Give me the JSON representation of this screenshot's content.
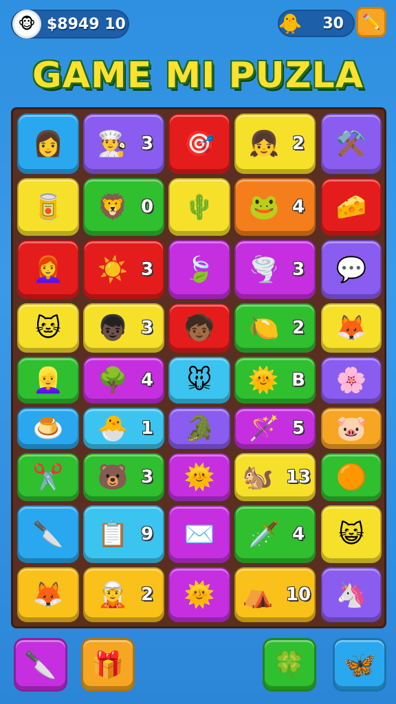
{
  "topbar": {
    "coins": "$8949 10",
    "coin_icon": "face-icon",
    "energy": "30",
    "energy_icon": "chick-icon",
    "edit_icon": "pencil-icon"
  },
  "title": "GAME MI PUZLA",
  "grid": {
    "rows": [
      [
        {
          "color": "blue",
          "icon": "👩",
          "icon_name": "woman-red-hair-icon",
          "count": ""
        },
        {
          "color": "purple",
          "icon": "👨‍🍳",
          "icon_name": "chef-icon",
          "count": "3"
        },
        {
          "color": "red",
          "icon": "🎯",
          "icon_name": "arrow-target-icon",
          "count": ""
        },
        {
          "color": "yellow",
          "icon": "👧",
          "icon_name": "girl-icon",
          "count": "2"
        },
        {
          "color": "purple",
          "icon": "⚒️",
          "icon_name": "tools-icon",
          "count": ""
        }
      ],
      [
        {
          "color": "yellow",
          "icon": "🥫",
          "icon_name": "box-character-icon",
          "count": ""
        },
        {
          "color": "green",
          "icon": "🦁",
          "icon_name": "orange-monster-icon",
          "count": "0"
        },
        {
          "color": "yellow",
          "icon": "🌵",
          "icon_name": "green-spiky-icon",
          "count": ""
        },
        {
          "color": "orange",
          "icon": "🐸",
          "icon_name": "green-box-monster-icon",
          "count": "4"
        },
        {
          "color": "red",
          "icon": "🧀",
          "icon_name": "yellow-block-icon",
          "count": ""
        }
      ],
      [
        {
          "color": "red",
          "icon": "👩‍🦰",
          "icon_name": "red-hood-girl-icon",
          "count": ""
        },
        {
          "color": "red",
          "icon": "☀️",
          "icon_name": "red-sun-icon",
          "count": "3"
        },
        {
          "color": "magenta",
          "icon": "🍃",
          "icon_name": "leaf-icon",
          "count": ""
        },
        {
          "color": "magenta",
          "icon": "🌪️",
          "icon_name": "tornado-icon",
          "count": "3"
        },
        {
          "color": "purple",
          "icon": "💬",
          "icon_name": "orange-bubble-icon",
          "count": ""
        }
      ],
      [
        {
          "color": "yellow",
          "icon": "🐱",
          "icon_name": "pink-cat-icon",
          "count": ""
        },
        {
          "color": "yellow",
          "icon": "👦🏿",
          "icon_name": "dark-hair-kid-icon",
          "count": "3"
        },
        {
          "color": "red",
          "icon": "🧒🏾",
          "icon_name": "leaf-crown-kid-icon",
          "count": ""
        },
        {
          "color": "green",
          "icon": "🍋",
          "icon_name": "yellow-blob-icon",
          "count": "2"
        },
        {
          "color": "yellow",
          "icon": "🦊",
          "icon_name": "red-fox-icon",
          "count": ""
        }
      ],
      [
        {
          "color": "green",
          "icon": "👱‍♀️",
          "icon_name": "blonde-girl-icon",
          "count": ""
        },
        {
          "color": "magenta",
          "icon": "🌳",
          "icon_name": "tree-stump-icon",
          "count": "4"
        },
        {
          "color": "lightblue",
          "icon": "🐭",
          "icon_name": "mouse-face-icon",
          "count": ""
        },
        {
          "color": "green",
          "icon": "🌞",
          "icon_name": "sun-face-icon",
          "count": "B"
        },
        {
          "color": "purple",
          "icon": "🌸",
          "icon_name": "red-flower-icon",
          "count": ""
        }
      ],
      [
        {
          "color": "blue",
          "icon": "🍮",
          "icon_name": "pudding-icon",
          "count": ""
        },
        {
          "color": "lightblue",
          "icon": "🐣",
          "icon_name": "chick-baby-icon",
          "count": "1"
        },
        {
          "color": "purple",
          "icon": "🐊",
          "icon_name": "green-lizard-icon",
          "count": ""
        },
        {
          "color": "magenta",
          "icon": "🪄",
          "icon_name": "wand-icon",
          "count": "5"
        },
        {
          "color": "lorange",
          "icon": "🐷",
          "icon_name": "pink-pig-icon",
          "count": ""
        }
      ],
      [
        {
          "color": "green",
          "icon": "✂️",
          "icon_name": "crossed-swords-icon",
          "count": ""
        },
        {
          "color": "green",
          "icon": "🐻",
          "icon_name": "brown-bear-icon",
          "count": "3"
        },
        {
          "color": "magenta",
          "icon": "🌞",
          "icon_name": "orange-sun-icon",
          "count": ""
        },
        {
          "color": "yellow",
          "icon": "🐿️",
          "icon_name": "squirrel-icon",
          "count": "13"
        },
        {
          "color": "green",
          "icon": "🟠",
          "icon_name": "orange-blob-icon",
          "count": ""
        }
      ],
      [
        {
          "color": "blue",
          "icon": "🔪",
          "icon_name": "knife-icon",
          "count": ""
        },
        {
          "color": "lightblue",
          "icon": "📋",
          "icon_name": "notepad-icon",
          "count": "9"
        },
        {
          "color": "magenta",
          "icon": "✉️",
          "icon_name": "envelope-icon",
          "count": ""
        },
        {
          "color": "green",
          "icon": "🗡️",
          "icon_name": "dagger-icon",
          "count": "4"
        },
        {
          "color": "yellow",
          "icon": "😺",
          "icon_name": "red-cat-icon",
          "count": ""
        }
      ],
      [
        {
          "color": "gold",
          "icon": "🦊",
          "icon_name": "orange-fox-icon",
          "count": ""
        },
        {
          "color": "gold",
          "icon": "🧝",
          "icon_name": "elf-icon",
          "count": "2"
        },
        {
          "color": "magenta",
          "icon": "🌞",
          "icon_name": "sun-creature-icon",
          "count": ""
        },
        {
          "color": "gold",
          "icon": "⛺",
          "icon_name": "tent-icon",
          "count": "10"
        },
        {
          "color": "purple",
          "icon": "🦄",
          "icon_name": "white-unicorn-icon",
          "count": ""
        }
      ]
    ]
  },
  "bottom": {
    "buttons": [
      {
        "icon": "🔪",
        "icon_name": "blade-icon",
        "color": "#c52fe0"
      },
      {
        "icon": "🎁",
        "icon_name": "wrapped-gift-icon",
        "color": "#f6a623"
      },
      {
        "icon": "🍀",
        "icon_name": "clover-icon",
        "color": "#2fbf2f"
      },
      {
        "icon": "🦋",
        "icon_name": "butterfly-icon",
        "color": "#29a8f0"
      }
    ]
  }
}
